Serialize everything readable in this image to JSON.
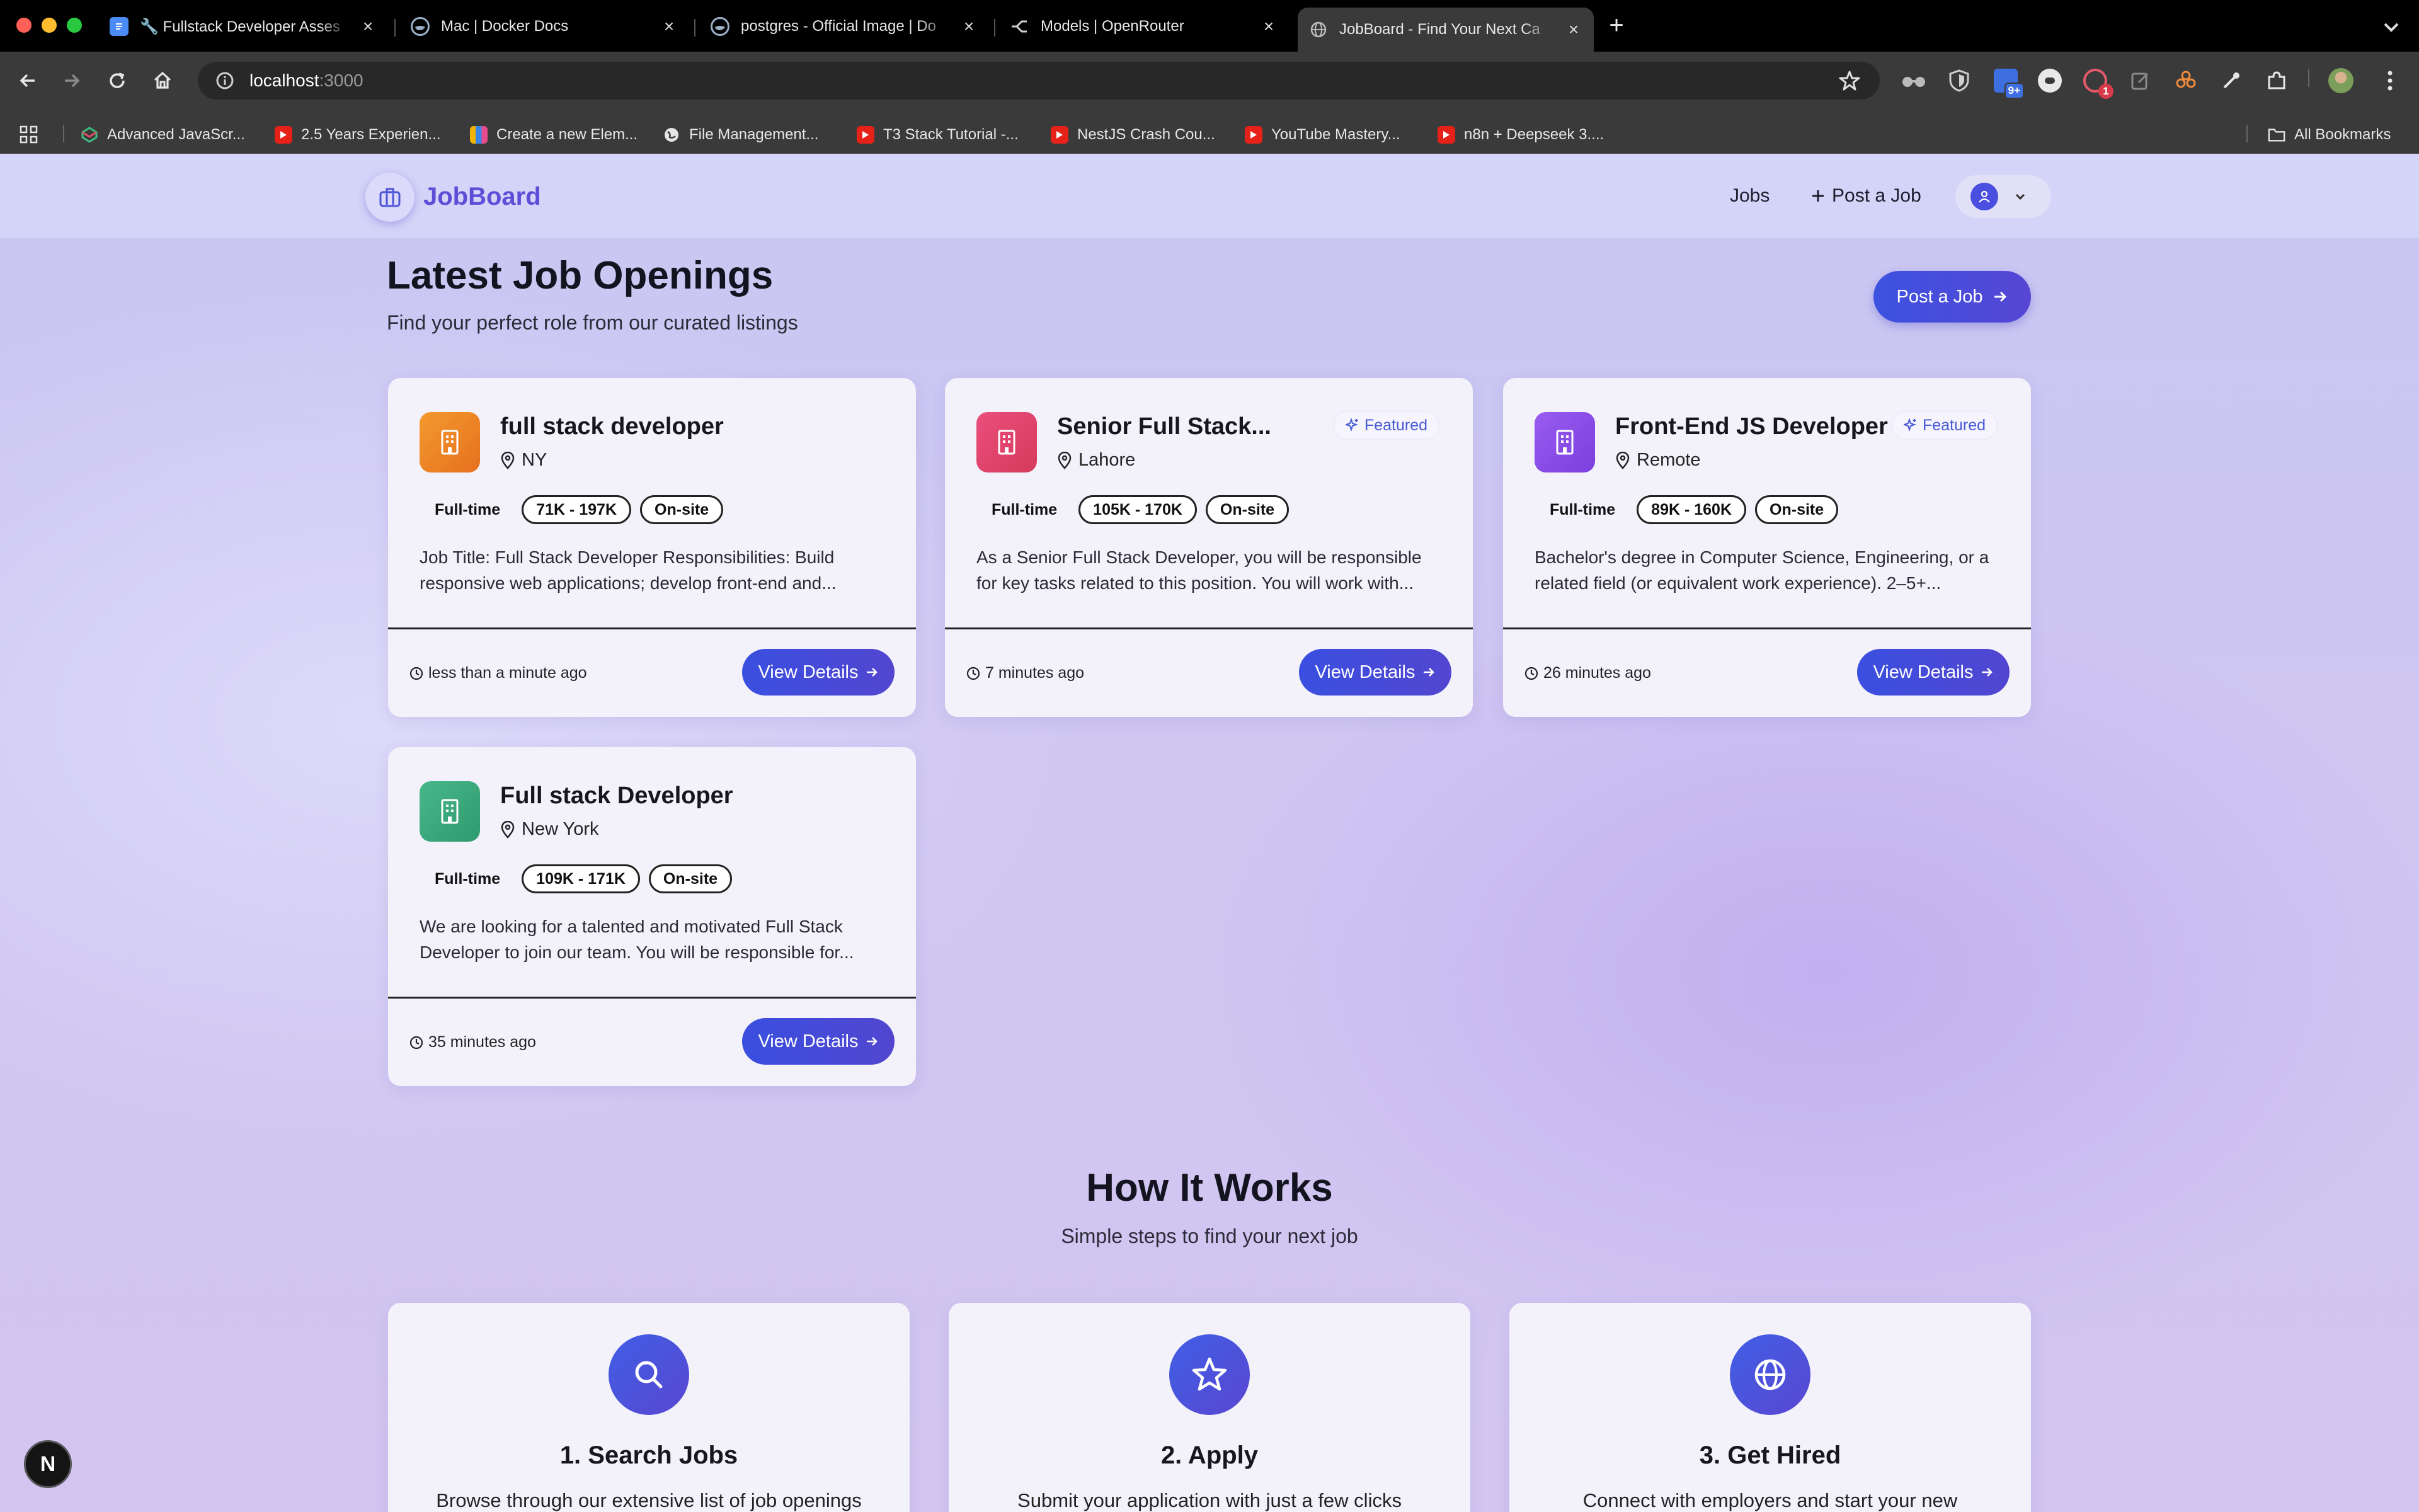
{
  "browser": {
    "tabs": [
      {
        "title": "🔧 Fullstack Developer Asses",
        "icon": "google-docs-icon"
      },
      {
        "title": "Mac | Docker Docs",
        "icon": "docker-icon"
      },
      {
        "title": "postgres - Official Image | Do",
        "icon": "docker-icon"
      },
      {
        "title": "Models | OpenRouter",
        "icon": "openrouter-icon"
      },
      {
        "title": "JobBoard - Find Your Next Ca",
        "icon": "globe-icon",
        "active": true
      }
    ],
    "address": {
      "host": "localhost",
      "port": ":3000"
    },
    "bookmarks": [
      {
        "label": "Advanced JavaScr...",
        "icon": "codepen-icon"
      },
      {
        "label": "2.5 Years Experien...",
        "icon": "youtube-icon"
      },
      {
        "label": "Create a new Elem...",
        "icon": "multicolor-icon"
      },
      {
        "label": "File Management...",
        "icon": "globe-icon"
      },
      {
        "label": "T3 Stack Tutorial -...",
        "icon": "youtube-icon"
      },
      {
        "label": "NestJS Crash Cou...",
        "icon": "youtube-icon"
      },
      {
        "label": "YouTube Mastery...",
        "icon": "youtube-icon"
      },
      {
        "label": "n8n + Deepseek 3....",
        "icon": "youtube-icon"
      }
    ],
    "all_bookmarks": "All Bookmarks",
    "extension_badge": "9+",
    "extension_badge2": "1"
  },
  "site": {
    "logo": "JobBoard",
    "nav": {
      "jobs": "Jobs",
      "post": "Post a Job"
    }
  },
  "jobs_section": {
    "title": "Latest Job Openings",
    "subtitle": "Find your perfect role from our curated listings",
    "post_button": "Post a Job"
  },
  "jobs": [
    {
      "title": "full stack developer",
      "location": "NY",
      "featured": false,
      "type": "Full-time",
      "salary": "71K - 197K",
      "mode": "On-site",
      "description": "Job Title: Full Stack Developer Responsibilities: Build responsive web applications; develop front-end and...",
      "posted": "less than a minute ago",
      "button": "View Details",
      "icon_color": "#ef8a28"
    },
    {
      "title": "Senior Full Stack...",
      "location": "Lahore",
      "featured": true,
      "featured_label": "Featured",
      "type": "Full-time",
      "salary": "105K - 170K",
      "mode": "On-site",
      "description": "As a Senior Full Stack Developer, you will be responsible for key tasks related to this position. You will work with...",
      "posted": "7 minutes ago",
      "button": "View Details",
      "icon_color": "#e0436e"
    },
    {
      "title": "Front-End JS Developer",
      "location": "Remote",
      "featured": true,
      "featured_label": "Featured",
      "type": "Full-time",
      "salary": "89K - 160K",
      "mode": "On-site",
      "description": "Bachelor's degree in Computer Science, Engineering, or a related field (or equivalent work experience). 2–5+...",
      "posted": "26 minutes ago",
      "button": "View Details",
      "icon_color": "#8a4de8"
    },
    {
      "title": "Full stack Developer",
      "location": "New York",
      "featured": false,
      "type": "Full-time",
      "salary": "109K - 171K",
      "mode": "On-site",
      "description": "We are looking for a talented and motivated Full Stack Developer to join our team. You will be responsible for...",
      "posted": "35 minutes ago",
      "button": "View Details",
      "icon_color": "#3aa57c"
    }
  ],
  "how": {
    "title": "How It Works",
    "subtitle": "Simple steps to find your next job",
    "steps": [
      {
        "title": "1. Search Jobs",
        "desc": "Browse through our extensive list of job openings",
        "icon": "search-icon"
      },
      {
        "title": "2. Apply",
        "desc": "Submit your application with just a few clicks",
        "icon": "star-icon"
      },
      {
        "title": "3. Get Hired",
        "desc": "Connect with employers and start your new",
        "icon": "globe-icon"
      }
    ]
  },
  "dev_badge": "N"
}
